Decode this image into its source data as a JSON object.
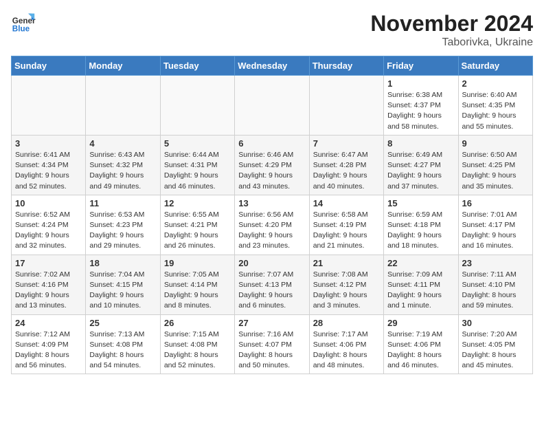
{
  "logo": {
    "general": "General",
    "blue": "Blue"
  },
  "title": "November 2024",
  "location": "Taborivka, Ukraine",
  "days_of_week": [
    "Sunday",
    "Monday",
    "Tuesday",
    "Wednesday",
    "Thursday",
    "Friday",
    "Saturday"
  ],
  "weeks": [
    [
      {
        "day": "",
        "detail": ""
      },
      {
        "day": "",
        "detail": ""
      },
      {
        "day": "",
        "detail": ""
      },
      {
        "day": "",
        "detail": ""
      },
      {
        "day": "",
        "detail": ""
      },
      {
        "day": "1",
        "detail": "Sunrise: 6:38 AM\nSunset: 4:37 PM\nDaylight: 9 hours\nand 58 minutes."
      },
      {
        "day": "2",
        "detail": "Sunrise: 6:40 AM\nSunset: 4:35 PM\nDaylight: 9 hours\nand 55 minutes."
      }
    ],
    [
      {
        "day": "3",
        "detail": "Sunrise: 6:41 AM\nSunset: 4:34 PM\nDaylight: 9 hours\nand 52 minutes."
      },
      {
        "day": "4",
        "detail": "Sunrise: 6:43 AM\nSunset: 4:32 PM\nDaylight: 9 hours\nand 49 minutes."
      },
      {
        "day": "5",
        "detail": "Sunrise: 6:44 AM\nSunset: 4:31 PM\nDaylight: 9 hours\nand 46 minutes."
      },
      {
        "day": "6",
        "detail": "Sunrise: 6:46 AM\nSunset: 4:29 PM\nDaylight: 9 hours\nand 43 minutes."
      },
      {
        "day": "7",
        "detail": "Sunrise: 6:47 AM\nSunset: 4:28 PM\nDaylight: 9 hours\nand 40 minutes."
      },
      {
        "day": "8",
        "detail": "Sunrise: 6:49 AM\nSunset: 4:27 PM\nDaylight: 9 hours\nand 37 minutes."
      },
      {
        "day": "9",
        "detail": "Sunrise: 6:50 AM\nSunset: 4:25 PM\nDaylight: 9 hours\nand 35 minutes."
      }
    ],
    [
      {
        "day": "10",
        "detail": "Sunrise: 6:52 AM\nSunset: 4:24 PM\nDaylight: 9 hours\nand 32 minutes."
      },
      {
        "day": "11",
        "detail": "Sunrise: 6:53 AM\nSunset: 4:23 PM\nDaylight: 9 hours\nand 29 minutes."
      },
      {
        "day": "12",
        "detail": "Sunrise: 6:55 AM\nSunset: 4:21 PM\nDaylight: 9 hours\nand 26 minutes."
      },
      {
        "day": "13",
        "detail": "Sunrise: 6:56 AM\nSunset: 4:20 PM\nDaylight: 9 hours\nand 23 minutes."
      },
      {
        "day": "14",
        "detail": "Sunrise: 6:58 AM\nSunset: 4:19 PM\nDaylight: 9 hours\nand 21 minutes."
      },
      {
        "day": "15",
        "detail": "Sunrise: 6:59 AM\nSunset: 4:18 PM\nDaylight: 9 hours\nand 18 minutes."
      },
      {
        "day": "16",
        "detail": "Sunrise: 7:01 AM\nSunset: 4:17 PM\nDaylight: 9 hours\nand 16 minutes."
      }
    ],
    [
      {
        "day": "17",
        "detail": "Sunrise: 7:02 AM\nSunset: 4:16 PM\nDaylight: 9 hours\nand 13 minutes."
      },
      {
        "day": "18",
        "detail": "Sunrise: 7:04 AM\nSunset: 4:15 PM\nDaylight: 9 hours\nand 10 minutes."
      },
      {
        "day": "19",
        "detail": "Sunrise: 7:05 AM\nSunset: 4:14 PM\nDaylight: 9 hours\nand 8 minutes."
      },
      {
        "day": "20",
        "detail": "Sunrise: 7:07 AM\nSunset: 4:13 PM\nDaylight: 9 hours\nand 6 minutes."
      },
      {
        "day": "21",
        "detail": "Sunrise: 7:08 AM\nSunset: 4:12 PM\nDaylight: 9 hours\nand 3 minutes."
      },
      {
        "day": "22",
        "detail": "Sunrise: 7:09 AM\nSunset: 4:11 PM\nDaylight: 9 hours\nand 1 minute."
      },
      {
        "day": "23",
        "detail": "Sunrise: 7:11 AM\nSunset: 4:10 PM\nDaylight: 8 hours\nand 59 minutes."
      }
    ],
    [
      {
        "day": "24",
        "detail": "Sunrise: 7:12 AM\nSunset: 4:09 PM\nDaylight: 8 hours\nand 56 minutes."
      },
      {
        "day": "25",
        "detail": "Sunrise: 7:13 AM\nSunset: 4:08 PM\nDaylight: 8 hours\nand 54 minutes."
      },
      {
        "day": "26",
        "detail": "Sunrise: 7:15 AM\nSunset: 4:08 PM\nDaylight: 8 hours\nand 52 minutes."
      },
      {
        "day": "27",
        "detail": "Sunrise: 7:16 AM\nSunset: 4:07 PM\nDaylight: 8 hours\nand 50 minutes."
      },
      {
        "day": "28",
        "detail": "Sunrise: 7:17 AM\nSunset: 4:06 PM\nDaylight: 8 hours\nand 48 minutes."
      },
      {
        "day": "29",
        "detail": "Sunrise: 7:19 AM\nSunset: 4:06 PM\nDaylight: 8 hours\nand 46 minutes."
      },
      {
        "day": "30",
        "detail": "Sunrise: 7:20 AM\nSunset: 4:05 PM\nDaylight: 8 hours\nand 45 minutes."
      }
    ]
  ]
}
